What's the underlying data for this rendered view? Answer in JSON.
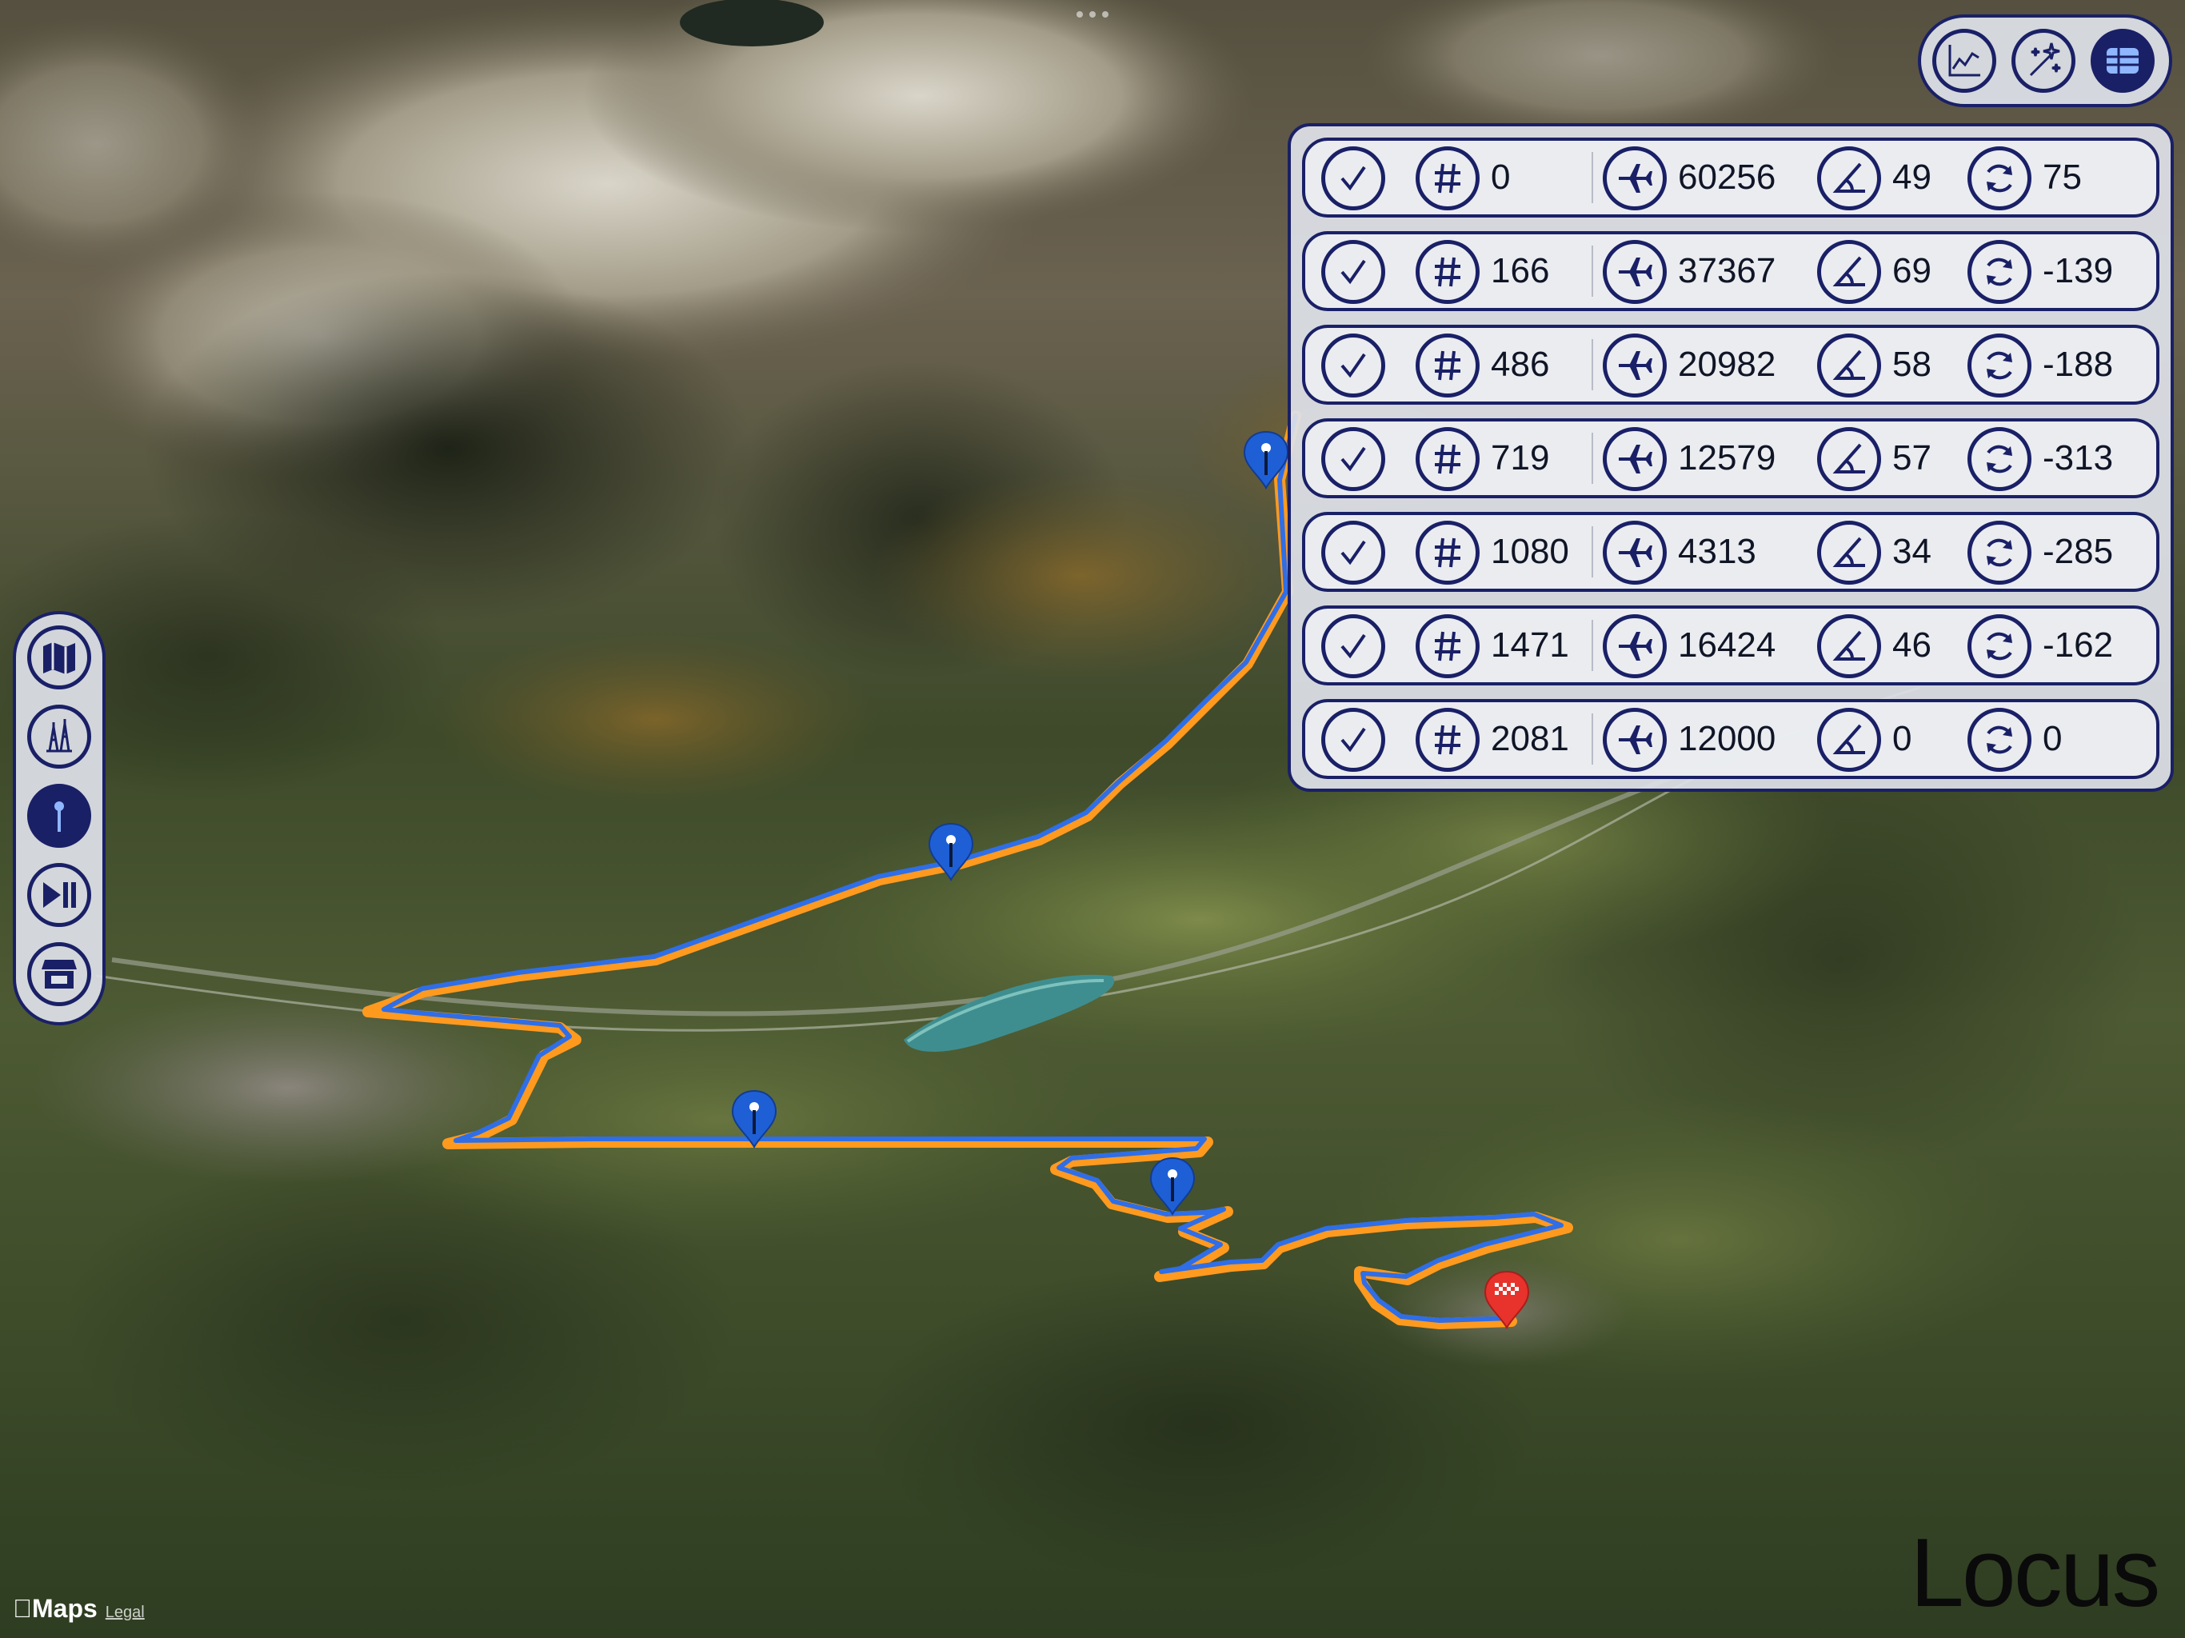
{
  "colors": {
    "accent": "#1a2066",
    "route_planned": "#ff9a1f",
    "route_actual": "#2f6ee6",
    "waypoint": "#1f5fd6",
    "finish": "#e8322c",
    "panel_bg": "#dee1e8"
  },
  "left_toolbar": [
    {
      "name": "map-view",
      "icon": "map-icon",
      "active": false
    },
    {
      "name": "altitude-profile",
      "icon": "antenna-tower-icon",
      "active": false
    },
    {
      "name": "waypoints",
      "icon": "pin-icon",
      "active": true
    },
    {
      "name": "playback",
      "icon": "play-pause-icon",
      "active": false
    },
    {
      "name": "store",
      "icon": "storefront-icon",
      "active": false
    }
  ],
  "top_toolbar": [
    {
      "name": "chart",
      "icon": "line-chart-icon",
      "active": false
    },
    {
      "name": "effects",
      "icon": "sparkles-icon",
      "active": false
    },
    {
      "name": "table",
      "icon": "table-icon",
      "active": true
    }
  ],
  "table": {
    "column_icons": [
      "checkmark-icon",
      "hash-icon",
      "airplane-icon",
      "angle-icon",
      "rotate-icon"
    ],
    "rows": [
      {
        "selected": true,
        "index": "0",
        "distance": "60256",
        "pitch": "49",
        "heading": "75"
      },
      {
        "selected": true,
        "index": "166",
        "distance": "37367",
        "pitch": "69",
        "heading": "-139"
      },
      {
        "selected": true,
        "index": "486",
        "distance": "20982",
        "pitch": "58",
        "heading": "-188"
      },
      {
        "selected": true,
        "index": "719",
        "distance": "12579",
        "pitch": "57",
        "heading": "-313"
      },
      {
        "selected": true,
        "index": "1080",
        "distance": "4313",
        "pitch": "34",
        "heading": "-285"
      },
      {
        "selected": true,
        "index": "1471",
        "distance": "16424",
        "pitch": "46",
        "heading": "-162"
      },
      {
        "selected": true,
        "index": "2081",
        "distance": "12000",
        "pitch": "0",
        "heading": "0"
      }
    ]
  },
  "map": {
    "attribution_brand": "Maps",
    "attribution_legal": "Legal",
    "markers": [
      {
        "type": "waypoint",
        "icon": "waypoint-pin-icon"
      },
      {
        "type": "waypoint",
        "icon": "waypoint-pin-icon"
      },
      {
        "type": "waypoint",
        "icon": "waypoint-pin-icon"
      },
      {
        "type": "waypoint",
        "icon": "waypoint-pin-icon"
      },
      {
        "type": "finish",
        "icon": "checkered-flag-pin-icon"
      }
    ]
  },
  "branding": {
    "logo_text": "Locus"
  }
}
